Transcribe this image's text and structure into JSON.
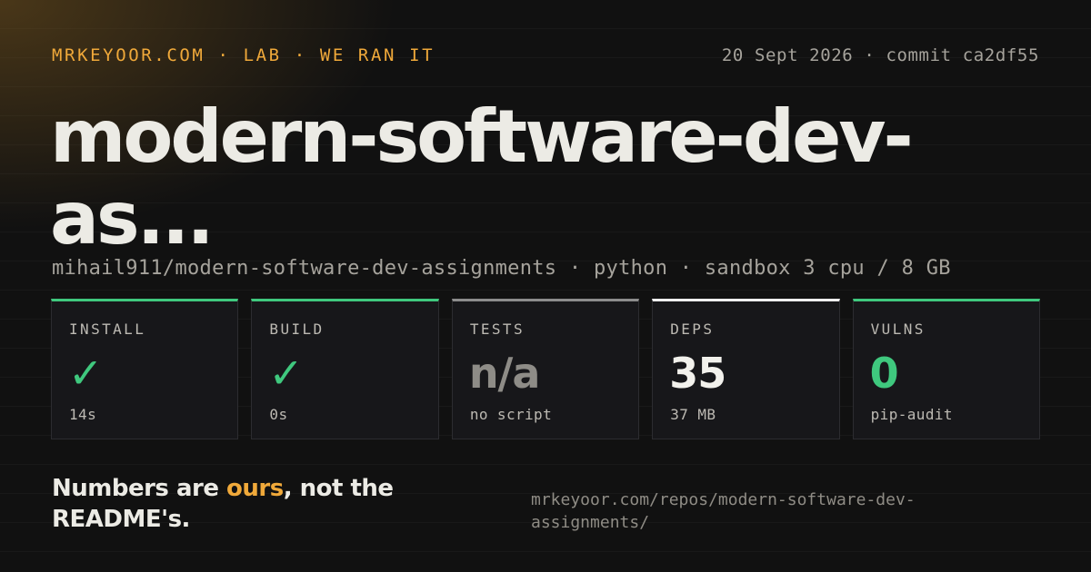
{
  "header": {
    "brand": "MRKEYOOR.COM · LAB · WE RAN IT",
    "meta": "20 Sept 2026 · commit ca2df55"
  },
  "title": "modern-software-dev-as...",
  "subtitle": "mihail911/modern-software-dev-assignments · python · sandbox 3 cpu / 8 GB",
  "cards": [
    {
      "label": "INSTALL",
      "value": "✓",
      "sub": "14s",
      "accent": "#3fc87e"
    },
    {
      "label": "BUILD",
      "value": "✓",
      "sub": "0s",
      "accent": "#3fc87e"
    },
    {
      "label": "TESTS",
      "value": "n/a",
      "sub": "no script",
      "accent": "#8c8c8c"
    },
    {
      "label": "DEPS",
      "value": "35",
      "sub": "37 MB",
      "accent": "#efefef"
    },
    {
      "label": "VULNS",
      "value": "0",
      "sub": "pip-audit",
      "accent": "#3fc87e"
    }
  ],
  "tagline": {
    "before": "Numbers are ",
    "accent": "ours",
    "after": ", not the README's."
  },
  "footer_url": "mrkeyoor.com/repos/modern-software-dev-assignments/",
  "colors": {
    "brand_accent": "#f0a93a",
    "success": "#3fc87e",
    "background": "#111111"
  }
}
